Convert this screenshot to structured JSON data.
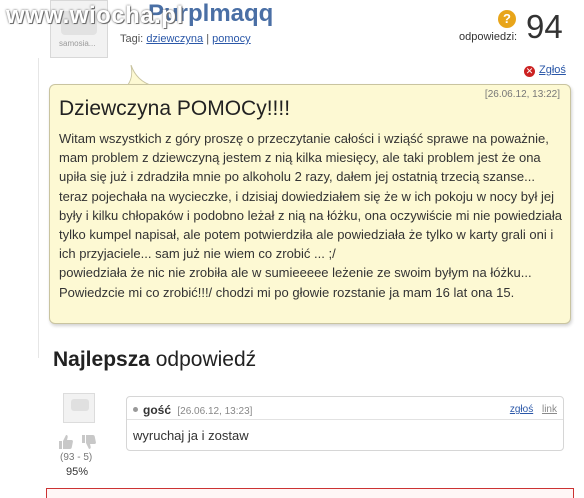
{
  "watermark": "www.wiocha.pl",
  "question": {
    "avatar_label": "samosia...",
    "username": "Purplmaqq",
    "tags_label": "Tagi:",
    "tags": [
      "dziewczyna",
      "pomocy"
    ],
    "tag_separator": "|",
    "answers_label": "odpowiedzi:",
    "answers_count": "94",
    "answers_icon": "?",
    "report_label": "Zgłoś",
    "date": "[26.06.12, 13:22]",
    "title": "Dziewczyna POMOCy!!!!",
    "body": "Witam wszystkich z góry proszę o przeczytanie całości i wziąść sprawe na poważnie, mam problem z dziewczyną jestem z nią kilka miesięcy, ale taki problem jest że ona upiła się już i zdradziła mnie po alkoholu 2 razy, dałem jej ostatnią trzecią szanse... teraz pojechała na wycieczke, i dzisiaj dowiedziałem się że w ich pokoju w nocy był jej były i kilku chłopaków i podobno leżał z nią na łóżku, ona oczywiście mi nie powiedziała tylko kumpel napisał, ale potem potwierdziła ale powiedziała że tylko w karty grali oni i ich przyjaciele... sam już nie wiem co zrobić ... ;/\npowiedziała że nic nie zrobiła ale w sumieeeee leżenie ze swoim byłym na łóżku... Powiedzcie mi co zrobić!!!/ chodzi mi po głowie rozstanie ja mam 16 lat ona 15."
  },
  "best_answer": {
    "heading_bold": "Najlepsza",
    "heading_rest": "odpowiedź",
    "author": "gość",
    "date": "[26.06.12, 13:23]",
    "report_label": "zgłoś",
    "link_label": "link",
    "text": "wyruchaj ja i zostaw",
    "votes_tally": "(93 - 5)",
    "votes_percent": "95%",
    "thumb_up_icon": "thumb-up-icon",
    "thumb_down_icon": "thumb-down-icon"
  },
  "colors": {
    "bubble_bg": "#fdf9d3",
    "link": "#2a57a8",
    "answers_icon": "#e8a51a",
    "report_icon": "#cc2222"
  }
}
